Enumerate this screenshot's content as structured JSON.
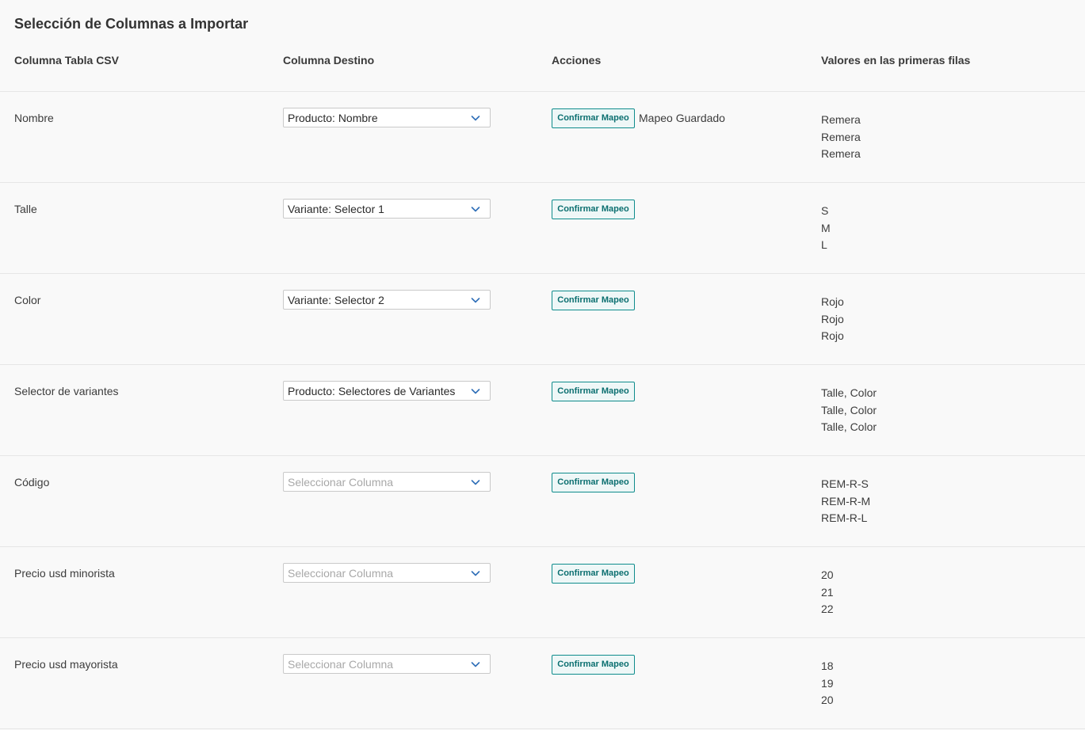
{
  "title": "Selección de Columnas a Importar",
  "headers": {
    "csv_column": "Columna Tabla CSV",
    "target_column": "Columna Destino",
    "actions": "Acciones",
    "values": "Valores en las primeras filas"
  },
  "confirm_label": "Confirmar Mapeo",
  "placeholder": "Seleccionar Columna",
  "rows": [
    {
      "csv": "Nombre",
      "target": "Producto: Nombre",
      "saved": "Mapeo Guardado",
      "values": [
        "Remera",
        "Remera",
        "Remera"
      ]
    },
    {
      "csv": "Talle",
      "target": "Variante: Selector 1",
      "saved": "",
      "values": [
        "S",
        "M",
        "L"
      ]
    },
    {
      "csv": "Color",
      "target": "Variante: Selector 2",
      "saved": "",
      "values": [
        "Rojo",
        "Rojo",
        "Rojo"
      ]
    },
    {
      "csv": "Selector de variantes",
      "target": "Producto: Selectores de Variantes",
      "saved": "",
      "values": [
        "Talle, Color",
        "Talle, Color",
        "Talle, Color"
      ]
    },
    {
      "csv": "Código",
      "target": "",
      "saved": "",
      "values": [
        "REM-R-S",
        "REM-R-M",
        "REM-R-L"
      ]
    },
    {
      "csv": "Precio usd minorista",
      "target": "",
      "saved": "",
      "values": [
        "20",
        "21",
        "22"
      ]
    },
    {
      "csv": "Precio usd mayorista",
      "target": "",
      "saved": "",
      "values": [
        "18",
        "19",
        "20"
      ]
    }
  ],
  "colors": {
    "accent": "#0e8c8c",
    "button_bg": "#eef7f7",
    "chevron": "#2f6fb8"
  },
  "icons": {
    "dropdown": "chevron-down-icon"
  }
}
